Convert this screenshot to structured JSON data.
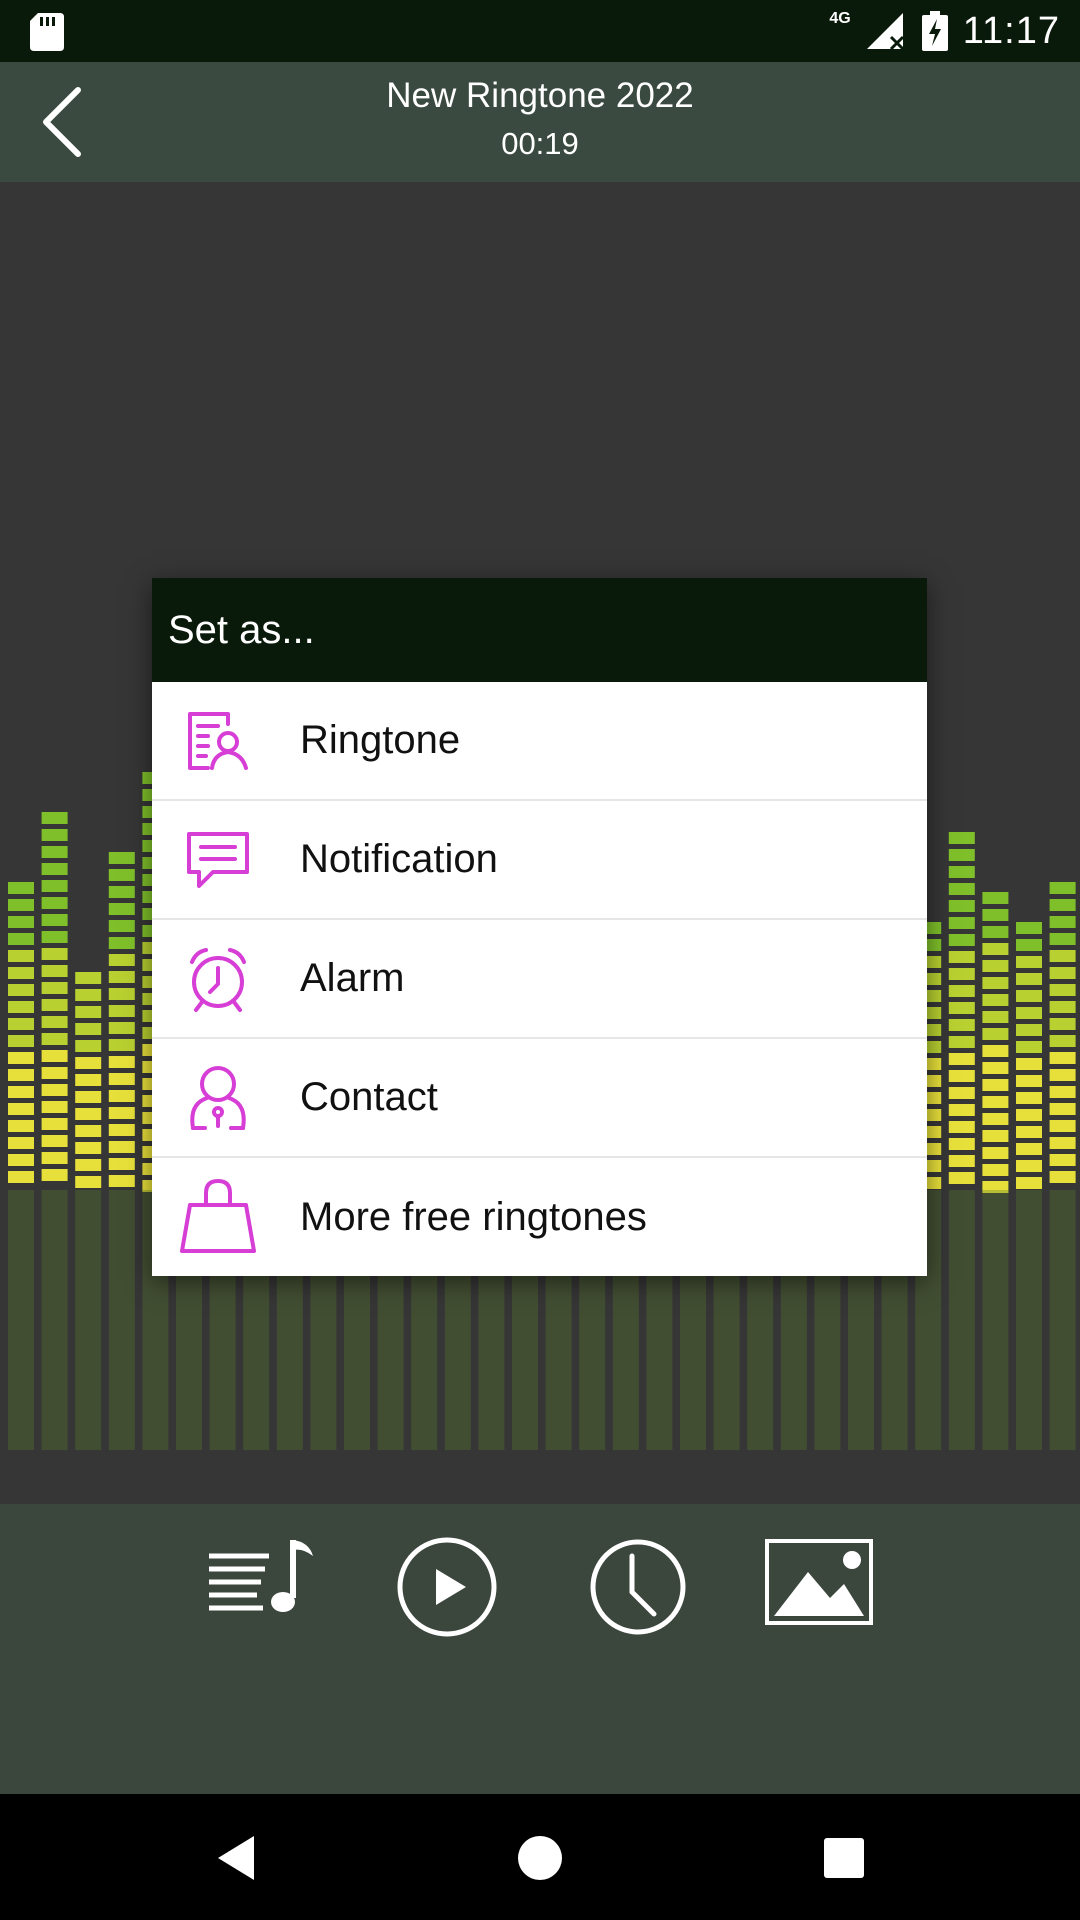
{
  "status_bar": {
    "network": "4G",
    "time": "11:17",
    "icons": [
      "sd-card-icon",
      "signal-icon",
      "battery-charging-icon"
    ]
  },
  "header": {
    "title": "New Ringtone 2022",
    "duration": "00:19",
    "back_icon": "chevron-left-icon"
  },
  "dialog": {
    "title": "Set as...",
    "items": [
      {
        "label": "Ringtone",
        "icon": "ringtone-contact-card-icon"
      },
      {
        "label": "Notification",
        "icon": "chat-bubble-icon"
      },
      {
        "label": "Alarm",
        "icon": "alarm-clock-icon"
      },
      {
        "label": "Contact",
        "icon": "person-icon"
      },
      {
        "label": "More free ringtones",
        "icon": "shopping-bag-icon"
      }
    ],
    "accent_color": "#d63ed6"
  },
  "controls": {
    "buttons": [
      "playlist-icon",
      "play-icon",
      "clock-icon",
      "image-icon"
    ]
  },
  "nav_bar": {
    "buttons": [
      "back-triangle-icon",
      "home-circle-icon",
      "recents-square-icon"
    ]
  },
  "colors": {
    "status_bar": "#0a1a0a",
    "header": "#3b4a40",
    "background": "#363636",
    "equalizer_green": "#7fc02a",
    "equalizer_yellow": "#e8e03a"
  }
}
